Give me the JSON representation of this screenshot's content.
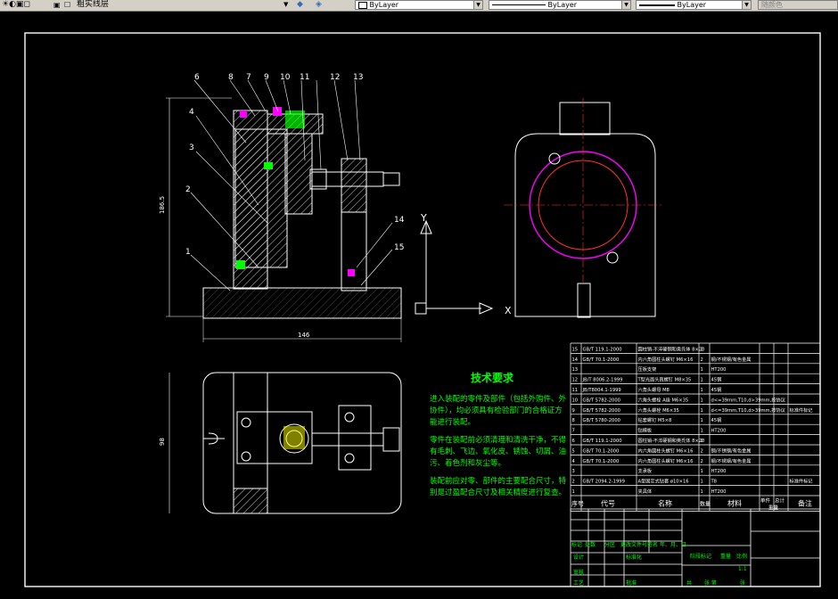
{
  "toolbar": {
    "layer_name": "粗实线层",
    "color_combo": "ByLayer",
    "linetype_combo": "ByLayer",
    "lineweight_combo": "ByLayer",
    "plotstyle_combo": "随颜色"
  },
  "drawing": {
    "balloons": [
      "6",
      "8",
      "7",
      "9",
      "10",
      "11",
      "12",
      "13",
      "4",
      "3",
      "2",
      "1",
      "14",
      "15"
    ],
    "dim_height": "186.5",
    "dim_width": "146",
    "dim_top_height": "98",
    "axis_y": "Y",
    "axis_x": "X",
    "tech_title": "技术要求",
    "tech_lines": [
      "进入装配的零件及部件（包括外购件、外",
      "协件），均必须具有检验部门的合格证方",
      "能进行装配。",
      "零件在装配前必须清理和清洗干净，不得",
      "有毛刺、飞边、氧化皮、锈蚀、切屑、油",
      "污、着色剂和灰尘等。",
      "装配前应对零、部件的主要配合尺寸，特",
      "别是过盈配合尺寸及相关精度进行复查。"
    ]
  },
  "bom": {
    "rows": [
      {
        "no": "15",
        "code": "GB/T 119.1-2000",
        "name": "圆柱销-不淬硬钢和奥氏体 8×20",
        "qty": "2",
        "mat": "",
        "note": ""
      },
      {
        "no": "14",
        "code": "GB/T 70.1-2000",
        "name": "内六角圆柱头螺钉 M6×16",
        "qty": "2",
        "mat": "钢/不锈钢/有色金属",
        "note": ""
      },
      {
        "no": "13",
        "code": "",
        "name": "压板支架",
        "qty": "1",
        "mat": "HT200",
        "note": ""
      },
      {
        "no": "12",
        "code": "JB/T 8006.2-1999",
        "name": "T型光面头直螺钉 M8×35",
        "qty": "1",
        "mat": "45钢",
        "note": ""
      },
      {
        "no": "11",
        "code": "JB/T8004.1-1999",
        "name": "六角头螺母 M8",
        "qty": "1",
        "mat": "45钢",
        "note": ""
      },
      {
        "no": "10",
        "code": "GB/T 5782-2000",
        "name": "六角头螺栓 A级 M6×35",
        "qty": "1",
        "mat": "d<=39mm,T10,d>39mm,按协议",
        "note": ""
      },
      {
        "no": "9",
        "code": "GB/T 5782-2000",
        "name": "六角头螺栓 M6×35",
        "qty": "1",
        "mat": "d<=39mm,T10,d>39mm,按协议",
        "note": "标准件标记"
      },
      {
        "no": "8",
        "code": "GB/T 5780-2000",
        "name": "钻套螺钉 M5×8",
        "qty": "1",
        "mat": "45钢",
        "note": ""
      },
      {
        "no": "7",
        "code": "",
        "name": "钻模板",
        "qty": "1",
        "mat": "HT200",
        "note": ""
      },
      {
        "no": "6",
        "code": "GB/T 119.1-2000",
        "name": "圆柱销-不淬硬钢和奥氏体 8×20",
        "qty": "2",
        "mat": "",
        "note": ""
      },
      {
        "no": "5",
        "code": "GB/T 70.1-2000",
        "name": "内六角圆柱头螺钉 M6×16",
        "qty": "2",
        "mat": "钢/不锈钢/有色金属",
        "note": ""
      },
      {
        "no": "4",
        "code": "GB/T 70.1-2000",
        "name": "内六角圆柱头螺钉 M6×16",
        "qty": "2",
        "mat": "钢/不锈钢/有色金属",
        "note": ""
      },
      {
        "no": "3",
        "code": "",
        "name": "支承板",
        "qty": "1",
        "mat": "HT200",
        "note": ""
      },
      {
        "no": "2",
        "code": "GB/T 2094.2-1999",
        "name": "A型固定式钻套 ø10×16",
        "qty": "1",
        "mat": "T8",
        "note": "标准件标记"
      },
      {
        "no": "1",
        "code": "",
        "name": "夹具体",
        "qty": "1",
        "mat": "HT200",
        "note": ""
      }
    ],
    "header": {
      "no": "序号",
      "code": "代号",
      "name": "名称",
      "qty": "数量",
      "mat": "材料",
      "unit_w": "单件",
      "total_w": "总计",
      "weight": "重量",
      "note": "备注"
    }
  },
  "titleblock": {
    "row_labels": [
      "标记",
      "处数",
      "分区",
      "更改文件号",
      "签名",
      "年、月、日"
    ],
    "design": "设计",
    "standard": "标准化",
    "review": "审核",
    "process": "工艺",
    "approve": "批准",
    "stage": "阶段标记",
    "weight": "重量",
    "scale": "比例",
    "scale_val": "1:1",
    "sheets": "共",
    "sheet_of": "张 第",
    "sheet_end": "张"
  }
}
